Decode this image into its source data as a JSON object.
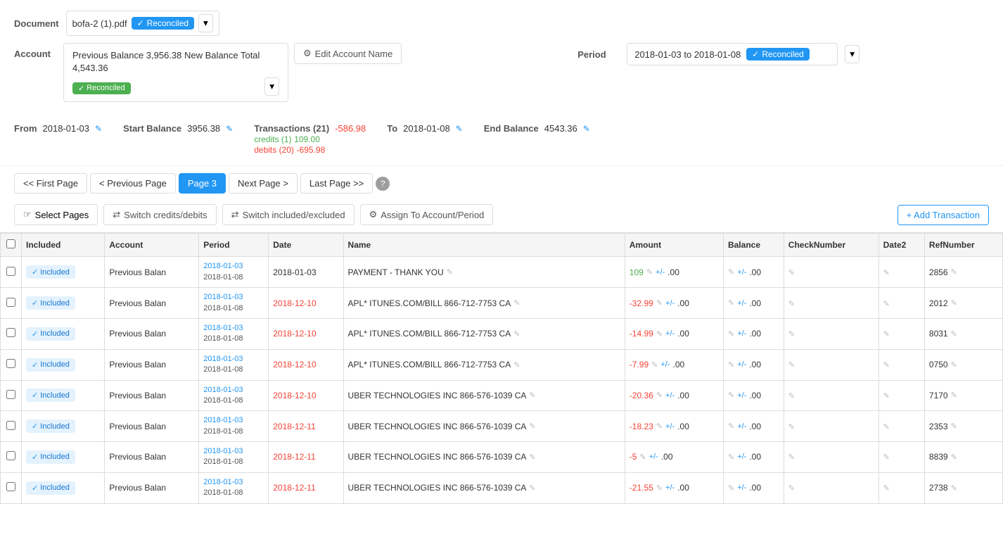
{
  "document": {
    "label": "Document",
    "filename": "bofa-2 (1).pdf",
    "status": "Reconciled"
  },
  "account": {
    "label": "Account",
    "text_line1": "Previous Balance 3,956.38 New Balance Total",
    "text_line2": "4,543.36",
    "status": "Reconciled",
    "edit_button": "Edit Account Name"
  },
  "period": {
    "label": "Period",
    "value": "2018-01-03 to 2018-01-08",
    "status": "Reconciled"
  },
  "stats": {
    "from_label": "From",
    "from_value": "2018-01-03",
    "start_balance_label": "Start Balance",
    "start_balance_value": "3956.38",
    "transactions_label": "Transactions (21)",
    "transactions_value": "-586.98",
    "credits_label": "credits (1)",
    "credits_value": "109.00",
    "debits_label": "debits (20)",
    "debits_value": "-695.98",
    "to_label": "To",
    "to_value": "2018-01-08",
    "end_balance_label": "End Balance",
    "end_balance_value": "4543.36"
  },
  "pagination": {
    "first": "<< First Page",
    "prev": "< Previous Page",
    "current": "Page 3",
    "next": "Next Page >",
    "last": "Last Page >>"
  },
  "actions": {
    "select_pages": "Select Pages",
    "switch_credits": "Switch credits/debits",
    "switch_included": "Switch included/excluded",
    "assign_account": "Assign To Account/Period",
    "add_transaction": "+ Add Transaction"
  },
  "table": {
    "headers": [
      "Included",
      "Account",
      "Period",
      "Date",
      "Name",
      "Amount",
      "Balance",
      "CheckNumber",
      "Date2",
      "RefNumber"
    ],
    "rows": [
      {
        "included": "Included",
        "account": "Previous Balan",
        "period_start": "2018-01-03",
        "period_end": "2018-01-08",
        "date": "2018-01-03",
        "name": "PAYMENT - THANK YOU",
        "amount": "109",
        "balance": "",
        "checknumber": "",
        "date2": "",
        "refnumber": "2856"
      },
      {
        "included": "Included",
        "account": "Previous Balan",
        "period_start": "2018-01-03",
        "period_end": "2018-01-08",
        "date": "2018-12-10",
        "name": "APL* ITUNES.COM/BILL 866-712-7753 CA",
        "amount": "-32.99",
        "balance": "",
        "checknumber": "",
        "date2": "",
        "refnumber": "2012"
      },
      {
        "included": "Included",
        "account": "Previous Balan",
        "period_start": "2018-01-03",
        "period_end": "2018-01-08",
        "date": "2018-12-10",
        "name": "APL* ITUNES.COM/BILL 866-712-7753 CA",
        "amount": "-14.99",
        "balance": "",
        "checknumber": "",
        "date2": "",
        "refnumber": "8031"
      },
      {
        "included": "Included",
        "account": "Previous Balan",
        "period_start": "2018-01-03",
        "period_end": "2018-01-08",
        "date": "2018-12-10",
        "name": "APL* ITUNES.COM/BILL 866-712-7753 CA",
        "amount": "-7.99",
        "balance": "",
        "checknumber": "",
        "date2": "",
        "refnumber": "0750"
      },
      {
        "included": "Included",
        "account": "Previous Balan",
        "period_start": "2018-01-03",
        "period_end": "2018-01-08",
        "date": "2018-12-10",
        "name": "UBER TECHNOLOGIES INC 866-576-1039 CA",
        "amount": "-20.36",
        "balance": "",
        "checknumber": "",
        "date2": "",
        "refnumber": "7170"
      },
      {
        "included": "Included",
        "account": "Previous Balan",
        "period_start": "2018-01-03",
        "period_end": "2018-01-08",
        "date": "2018-12-11",
        "name": "UBER TECHNOLOGIES INC 866-576-1039 CA",
        "amount": "-18.23",
        "balance": "",
        "checknumber": "",
        "date2": "",
        "refnumber": "2353"
      },
      {
        "included": "Included",
        "account": "Previous Balan",
        "period_start": "2018-01-03",
        "period_end": "2018-01-08",
        "date": "2018-12-11",
        "name": "UBER TECHNOLOGIES INC 866-576-1039 CA",
        "amount": "-5",
        "balance": "",
        "checknumber": "",
        "date2": "",
        "refnumber": "8839"
      },
      {
        "included": "Included",
        "account": "Previous Balan",
        "period_start": "2018-01-03",
        "period_end": "2018-01-08",
        "date": "2018-12-11",
        "name": "UBER TECHNOLOGIES INC 866-576-1039 CA",
        "amount": "-21.55",
        "balance": "",
        "checknumber": "",
        "date2": "",
        "refnumber": "2738"
      }
    ]
  }
}
